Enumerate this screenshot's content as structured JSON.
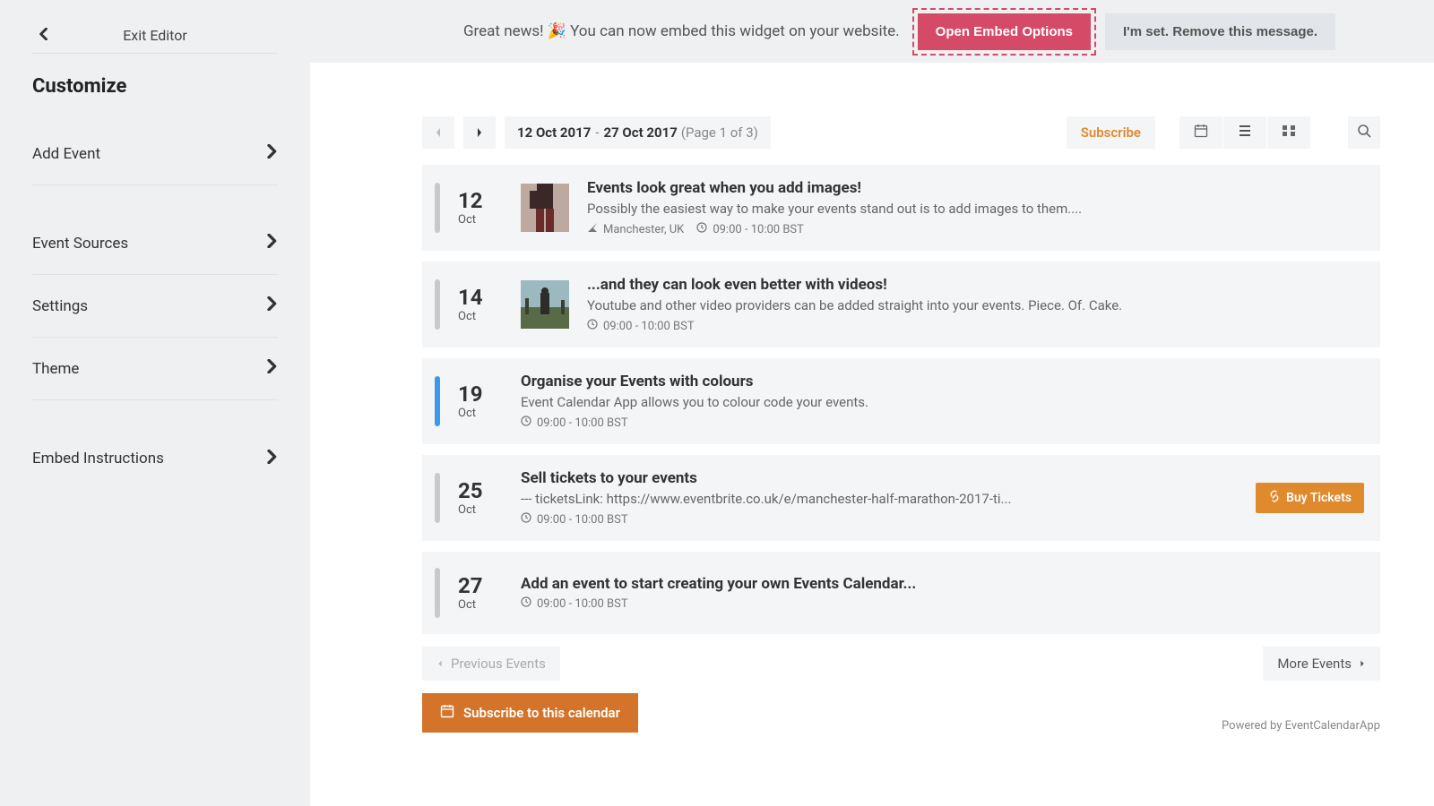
{
  "sidebar": {
    "exit_label": "Exit Editor",
    "title": "Customize",
    "items": [
      {
        "label": "Add Event"
      },
      {
        "label": "Event Sources"
      },
      {
        "label": "Settings"
      },
      {
        "label": "Theme"
      },
      {
        "label": "Embed Instructions"
      }
    ]
  },
  "topbar": {
    "message": "Great news! 🎉 You can now embed this widget on your website.",
    "open_embed": "Open Embed Options",
    "dismiss": "I'm set. Remove this message."
  },
  "toolbar": {
    "date_from": "12 Oct 2017",
    "date_to": "27 Oct 2017",
    "page_info": "(Page 1 of 3)",
    "subscribe": "Subscribe"
  },
  "events": [
    {
      "day": "12",
      "mon": "Oct",
      "title": "Events look great when you add images!",
      "desc": "Possibly the easiest way to make your events stand out is to add images to them....",
      "location": "Manchester, UK",
      "time": "09:00 - 10:00 BST",
      "color": "grey",
      "has_image": true,
      "has_location": true,
      "buy": false
    },
    {
      "day": "14",
      "mon": "Oct",
      "title": "...and they can look even better with videos!",
      "desc": "Youtube and other video providers can be added straight into your events. Piece. Of. Cake.",
      "location": "",
      "time": "09:00 - 10:00 BST",
      "color": "grey",
      "has_image": true,
      "has_location": false,
      "buy": false
    },
    {
      "day": "19",
      "mon": "Oct",
      "title": "Organise your Events with colours",
      "desc": "Event Calendar App allows you to colour code your events.",
      "location": "",
      "time": "09:00 - 10:00 BST",
      "color": "blue",
      "has_image": false,
      "has_location": false,
      "buy": false
    },
    {
      "day": "25",
      "mon": "Oct",
      "title": "Sell tickets to your events",
      "desc": "--- ticketsLink: https://www.eventbrite.co.uk/e/manchester-half-marathon-2017-ti...",
      "location": "",
      "time": "09:00 - 10:00 BST",
      "color": "grey",
      "has_image": false,
      "has_location": false,
      "buy": true,
      "buy_label": "Buy Tickets"
    },
    {
      "day": "27",
      "mon": "Oct",
      "title": "Add an event to start creating your own Events Calendar...",
      "desc": "",
      "location": "",
      "time": "09:00 - 10:00 BST",
      "color": "grey",
      "has_image": false,
      "has_location": false,
      "buy": false
    }
  ],
  "footer": {
    "prev": "Previous Events",
    "more": "More Events",
    "subscribe_full": "Subscribe to this calendar",
    "powered": "Powered by EventCalendarApp"
  }
}
